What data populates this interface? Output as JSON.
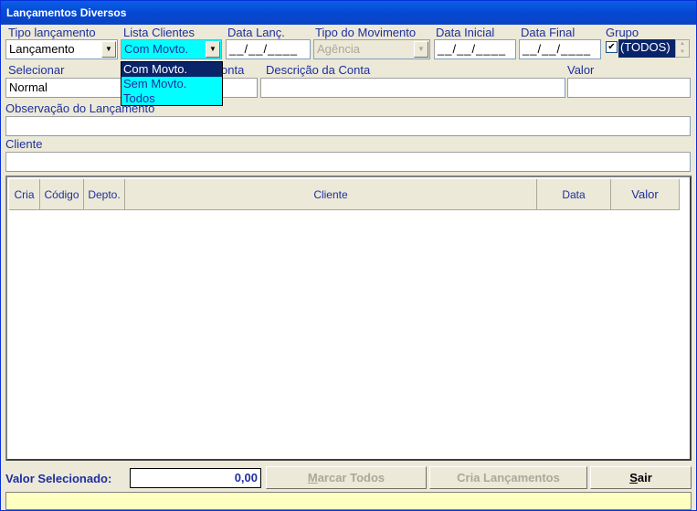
{
  "window": {
    "title": "Lançamentos Diversos"
  },
  "filters": {
    "tipo_lancamento": {
      "label": "Tipo lançamento",
      "value": "Lançamento"
    },
    "lista_clientes": {
      "label": "Lista Clientes",
      "value": "Com Movto.",
      "options": [
        "Com Movto.",
        "Sem Movto.",
        "Todos"
      ]
    },
    "data_lanc": {
      "label": "Data Lanç.",
      "value": "__/__/____"
    },
    "tipo_movimento": {
      "label": "Tipo do Movimento",
      "value": "Agência"
    },
    "data_inicial": {
      "label": "Data Inicial",
      "value": "__/__/____"
    },
    "data_final": {
      "label": "Data Final",
      "value": "__/__/____"
    },
    "grupo": {
      "label": "Grupo",
      "checked": true,
      "check_glyph": "✔",
      "value": "(TODOS)"
    }
  },
  "row2": {
    "selecionar": {
      "label": "Selecionar",
      "value": "Normal"
    },
    "conta": {
      "label": "onta",
      "value": ""
    },
    "descricao": {
      "label": "Descrição da Conta",
      "value": ""
    },
    "valor": {
      "label": "Valor",
      "value": ""
    }
  },
  "observacao": {
    "label": "Observação do Lançamento",
    "value": ""
  },
  "cliente": {
    "label": "Cliente",
    "value": ""
  },
  "grid": {
    "columns": [
      "Cria",
      "Código",
      "Depto.",
      "Cliente",
      "Data",
      "Valor"
    ],
    "rows": []
  },
  "footer": {
    "total_label": "Valor Selecionado:",
    "total_value": "0,00",
    "marcar_todos": {
      "pre": "",
      "accel": "M",
      "post": "arcar Todos"
    },
    "cria_lancamentos": "Cria Lançamentos",
    "sair": {
      "pre": "",
      "accel": "S",
      "post": "air"
    }
  },
  "status": {
    "text": ""
  },
  "colors": {
    "title_blue": "#0548d3",
    "label_blue": "#1e2fa0",
    "highlight_cyan": "#00ffff",
    "status_yellow": "#ffffc0"
  }
}
